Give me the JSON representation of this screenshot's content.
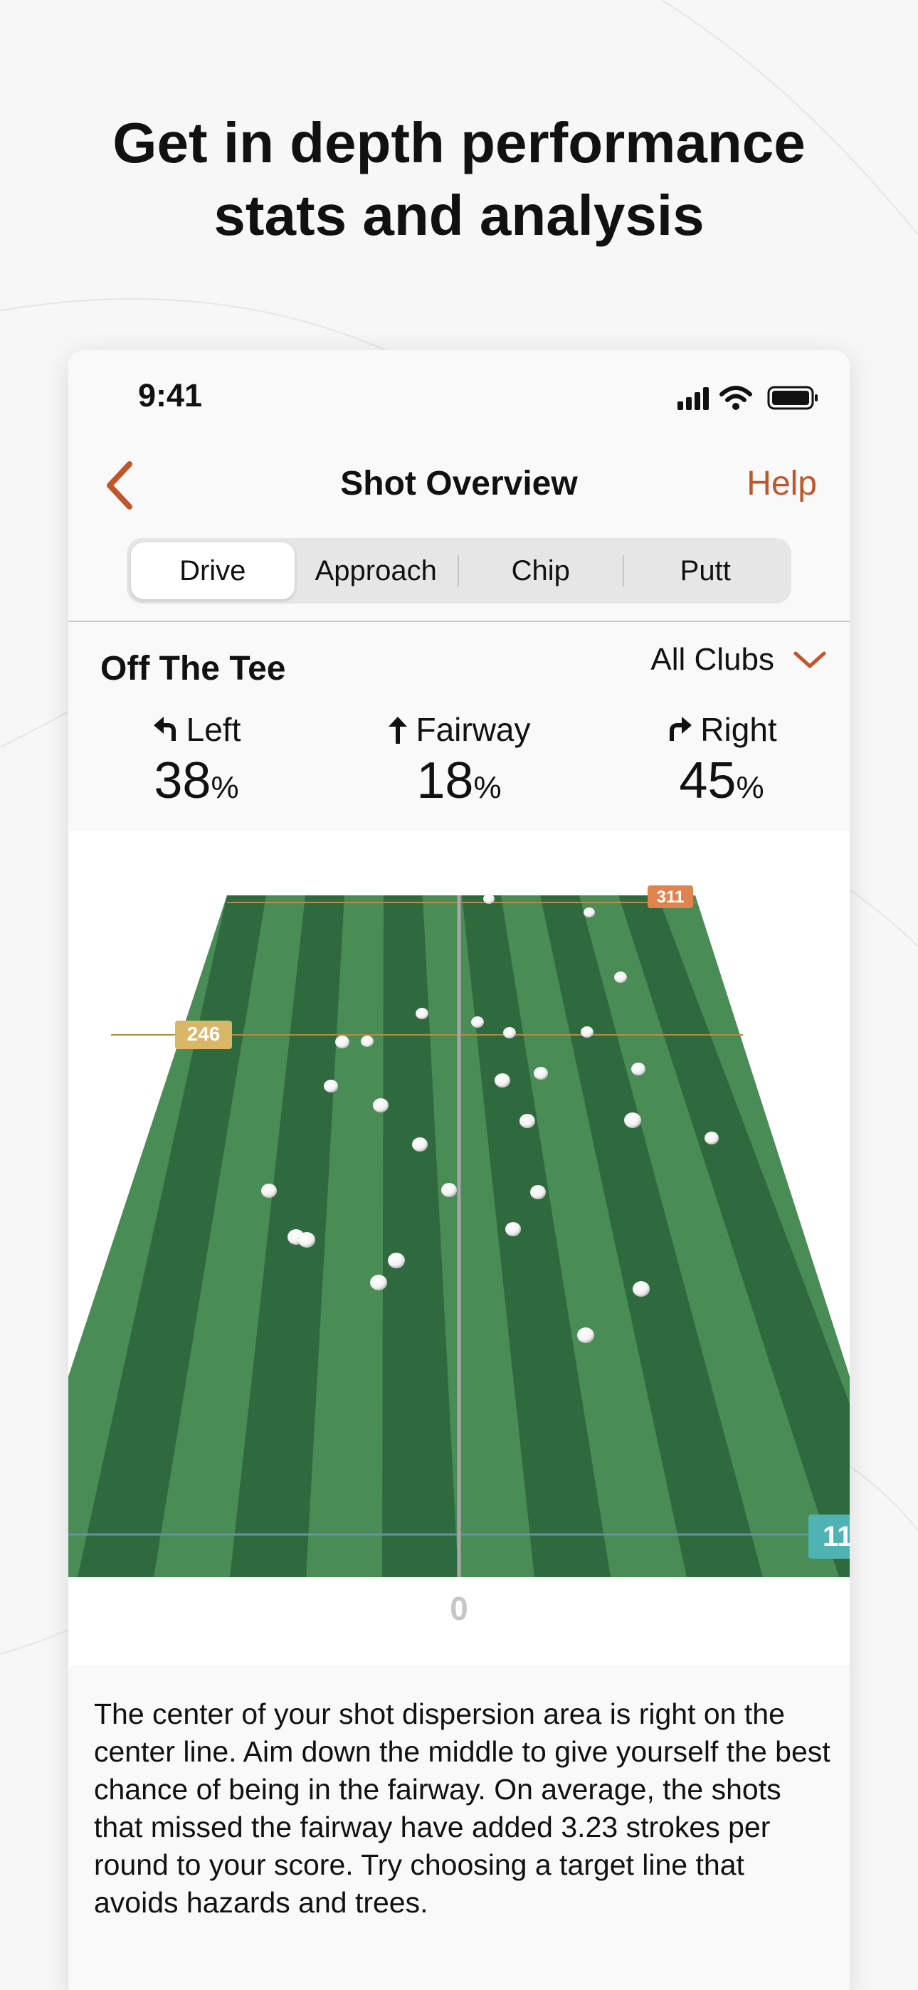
{
  "headline": {
    "line1": "Get in depth performance",
    "line2": "stats and analysis"
  },
  "status_bar": {
    "time": "9:41",
    "icons": [
      "signal-icon",
      "wifi-icon",
      "battery-icon"
    ]
  },
  "nav": {
    "back_icon": "chevron-left-icon",
    "title": "Shot Overview",
    "help": "Help"
  },
  "tabs": [
    {
      "label": "Drive",
      "active": true
    },
    {
      "label": "Approach",
      "active": false
    },
    {
      "label": "Chip",
      "active": false
    },
    {
      "label": "Putt",
      "active": false
    }
  ],
  "section": {
    "title": "Off The Tee",
    "club_filter": "All Clubs"
  },
  "stats": [
    {
      "label": "Left",
      "value": "38",
      "unit": "%",
      "icon": "turn-left-arrow-icon"
    },
    {
      "label": "Fairway",
      "value": "18",
      "unit": "%",
      "icon": "up-arrow-icon"
    },
    {
      "label": "Right",
      "value": "45",
      "unit": "%",
      "icon": "turn-right-arrow-icon"
    }
  ],
  "fairway": {
    "far_distance": "311",
    "mid_distance": "246",
    "near_distance": "11",
    "center_label": "0",
    "colors": {
      "stripe_light": "#4a8c56",
      "stripe_dark": "#2f6a3f",
      "accent": "#c0562a"
    }
  },
  "insight": "The center of your shot dispersion area is right on the center line. Aim down the middle to give yourself the best chance of being in the fairway. On average, the shots that missed the fairway have added 3.23 strokes per round to your score. Try choosing a target line that avoids hazards and trees."
}
